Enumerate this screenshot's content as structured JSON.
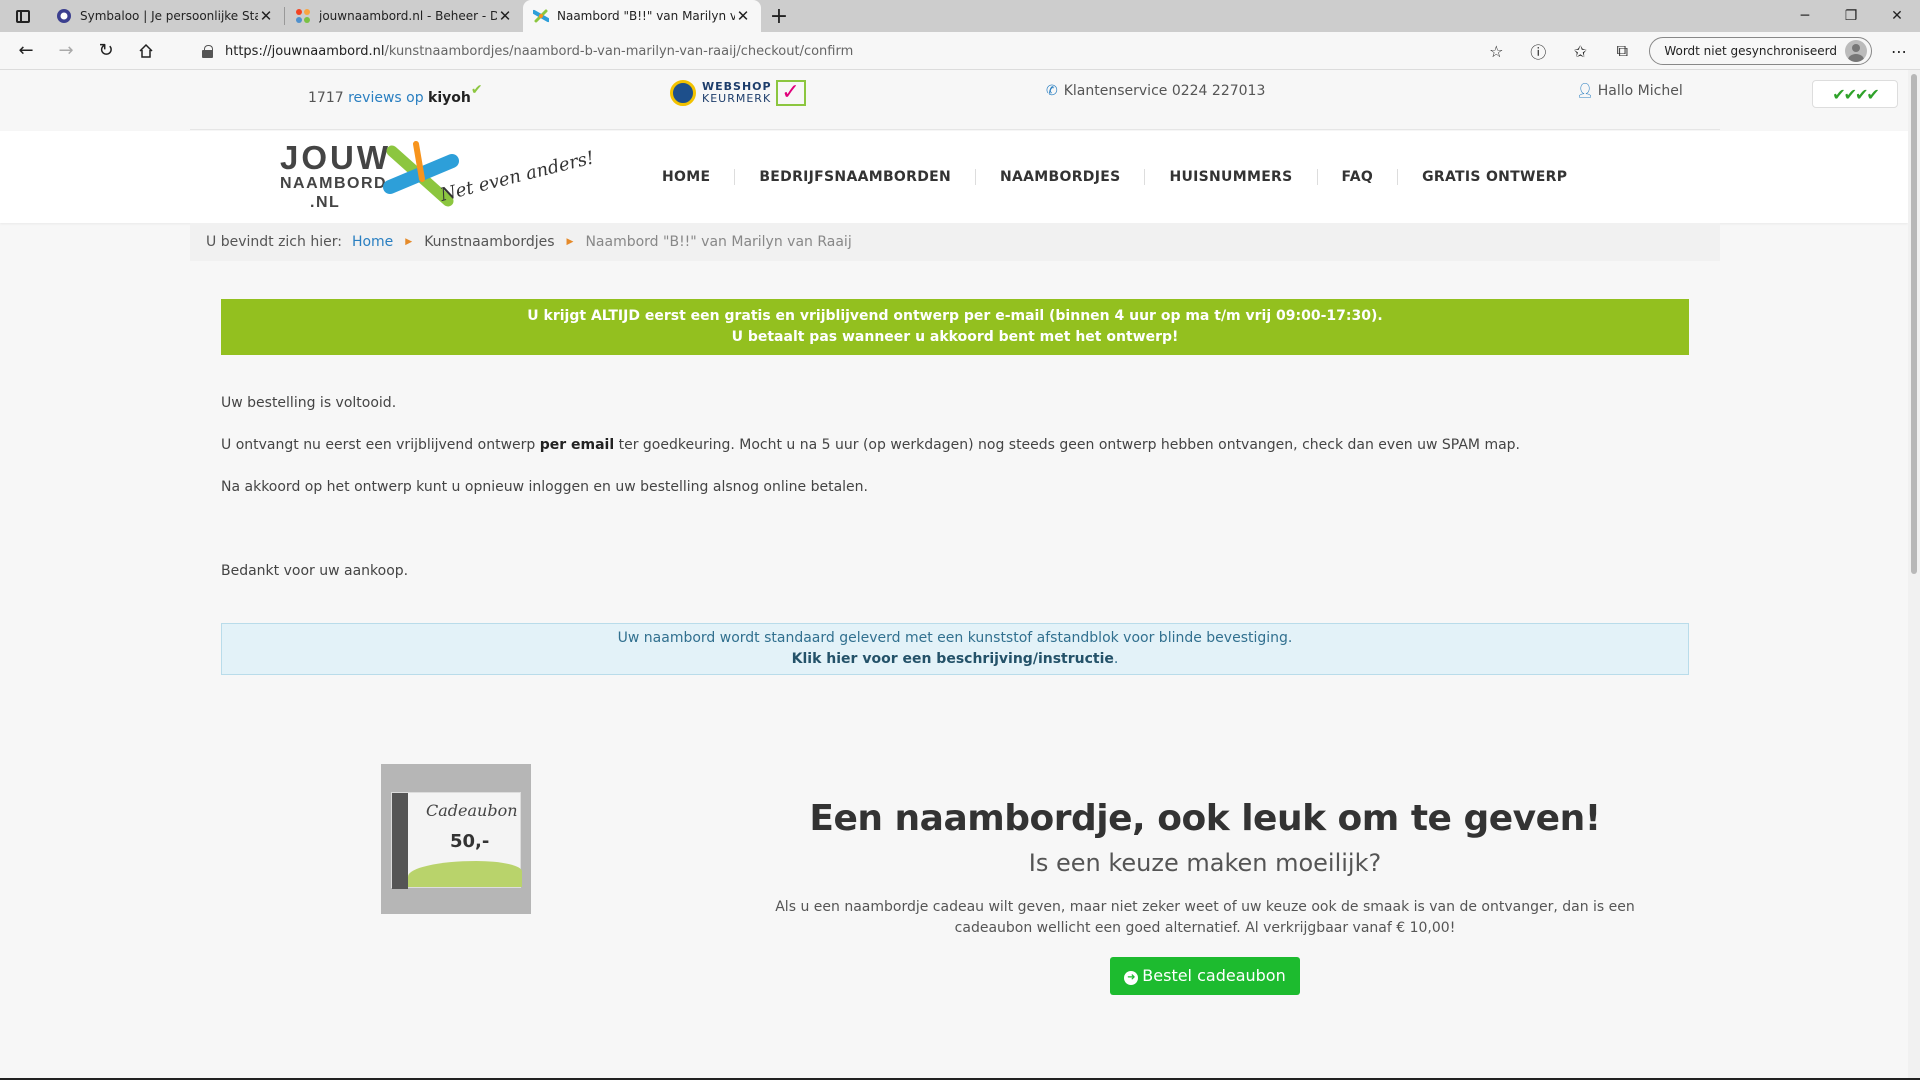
{
  "browser": {
    "tabs": [
      {
        "title": "Symbaloo | Je persoonlijke Startpagina",
        "icon": "symbaloo-icon"
      },
      {
        "title": "jouwnaambord.nl - Beheer - Dashboard",
        "icon": "joomla-icon"
      },
      {
        "title": "Naambord \"B!!\" van Marilyn van Raaij",
        "icon": "jouwnaambord-icon",
        "active": true
      }
    ],
    "url_domain": "https://jouwnaambord.nl",
    "url_path": "/kunstnaambordjes/naambord-b-van-marilyn-van-raaij/checkout/confirm",
    "sync_label": "Wordt niet gesynchroniseerd"
  },
  "topbar": {
    "reviews_count": "1717",
    "reviews_text": "reviews op",
    "reviews_brand": "kiyoh",
    "keurmerk_line1": "WEBSHOP",
    "keurmerk_line2": "KEURMERK",
    "service": "Klantenservice 0224 227013",
    "greeting": "Hallo Michel",
    "ticks": "✔✔✔✔"
  },
  "logo": {
    "line1": "JOUW",
    "line2": "NAAMBORD",
    "line3": ".NL",
    "slogan": "Net even anders!"
  },
  "nav": {
    "items": [
      "HOME",
      "BEDRIJFSNAAMBORDEN",
      "NAAMBORDJES",
      "HUISNUMMERS",
      "FAQ",
      "GRATIS ONTWERP"
    ]
  },
  "breadcrumb": {
    "prefix": "U bevindt zich hier:",
    "home": "Home",
    "category": "Kunstnaambordjes",
    "current": "Naambord \"B!!\" van Marilyn van Raaij"
  },
  "promo": {
    "line1": "U krijgt ALTIJD eerst een gratis en vrijblijvend ontwerp per e-mail (binnen 4 uur op ma t/m vrij 09:00-17:30).",
    "line2": "U betaalt pas wanneer u akkoord bent met het ontwerp!"
  },
  "confirmation": {
    "done": "Uw bestelling is voltooid.",
    "p2_before": "U ontvangt nu eerst een vrijblijvend ontwerp ",
    "p2_bold": "per email",
    "p2_after": " ter goedkeuring. Mocht u na 5 uur (op werkdagen) nog steeds geen ontwerp hebben ontvangen, check dan even uw SPAM map.",
    "p3": "Na akkoord op het ontwerp kunt u opnieuw inloggen en uw bestelling alsnog online betalen.",
    "thanks": "Bedankt voor uw aankoop."
  },
  "info": {
    "line1": "Uw naambord wordt standaard geleverd met een kunststof afstandblok voor blinde bevestiging.",
    "link": "Klik hier voor een beschrijving/instructie",
    "link_suffix": "."
  },
  "gift": {
    "card_title": "Cadeaubon",
    "card_amount": "50,-",
    "heading": "Een naambordje, ook leuk om te geven!",
    "subheading": "Is een keuze maken moeilijk?",
    "text": "Als u een naambordje cadeau wilt geven, maar niet zeker weet of uw keuze ook de smaak is van de ontvanger, dan is een cadeaubon wellicht een goed alternatief. Al verkrijgbaar vanaf € 10,00!",
    "button": "Bestel cadeaubon"
  },
  "colors": {
    "promo_green": "#93c01f",
    "link_blue": "#2a7fc1",
    "button_green": "#1dbb2f",
    "info_bg": "#e3f2f8"
  }
}
